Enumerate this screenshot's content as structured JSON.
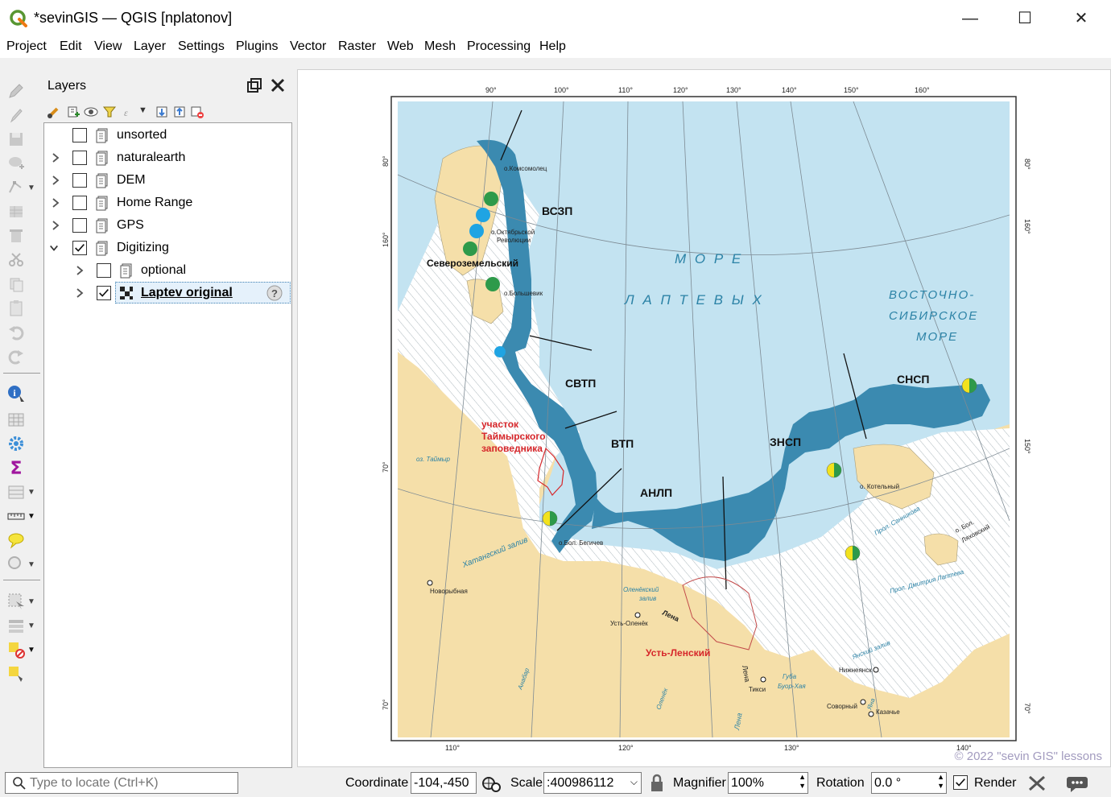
{
  "window": {
    "title": "*sevinGIS — QGIS [nplatonov]",
    "minimize": "—",
    "maximize": "☐",
    "close": "✕"
  },
  "menu": [
    "Project",
    "Edit",
    "View",
    "Layer",
    "Settings",
    "Plugins",
    "Vector",
    "Raster",
    "Web",
    "Mesh",
    "Processing",
    "Help"
  ],
  "layers_panel": {
    "title": "Layers",
    "items": [
      {
        "label": "unsorted",
        "checked": false,
        "expander": "none"
      },
      {
        "label": "naturalearth",
        "checked": false,
        "expander": "collapsed"
      },
      {
        "label": "DEM",
        "checked": false,
        "expander": "collapsed"
      },
      {
        "label": "Home Range",
        "checked": false,
        "expander": "collapsed"
      },
      {
        "label": "GPS",
        "checked": false,
        "expander": "collapsed"
      },
      {
        "label": "Digitizing",
        "checked": true,
        "expander": "expanded"
      },
      {
        "label": "optional",
        "checked": false,
        "expander": "collapsed"
      },
      {
        "label": "Laptev original",
        "checked": true,
        "expander": "collapsed",
        "selected": true,
        "indicator": "?"
      }
    ]
  },
  "map": {
    "top_longitudes": [
      "90°",
      "100°",
      "110°",
      "120°",
      "130°",
      "140°",
      "150°",
      "160°"
    ],
    "bottom_longitudes": [
      "110°",
      "120°",
      "130°",
      "140°"
    ],
    "left_latitudes": [
      "80°",
      "160°",
      "150°",
      "70°"
    ],
    "right_latitudes": [
      "80°",
      "160°",
      "150°",
      "70°"
    ],
    "labels": {
      "sea1": "М О Р Е",
      "sea2": "Л А П Т Е В Ы Х",
      "ess1": "ВОСТОЧНО-",
      "ess2": "СИБИРСКОЕ",
      "ess3": "МОРЕ",
      "vszp": "ВСЗП",
      "svtp": "СВТП",
      "vtp": "ВТП",
      "anlp": "АНЛП",
      "znsp": "ЗНСП",
      "snsp": "СНСП",
      "severozem": "Североземельский",
      "komsomolets": "о.Комсомолец",
      "oktrev1": "о.Октябрьской",
      "oktrev2": "Революции",
      "bolshevik": "о.Большевик",
      "taymyr1": "участок",
      "taymyr2": "Таймырского",
      "taymyr3": "заповедника",
      "oztaymyr": "оз. Таймыр",
      "khatanga": "Хатангский залив",
      "begichev": "о.Бол. Бегичев",
      "novorybnaya": "Новорыбная",
      "olenek_bay1": "Оленёкский",
      "olenek_bay2": "залив",
      "ust_olenek": "Усть-Оленёк",
      "lena": "Лена",
      "lena2": "Лена",
      "lena3": "Лена",
      "ust_lensky": "Усть-Ленский",
      "tiksi": "Тикси",
      "buor1": "Губа",
      "buor2": "Буор-Хая",
      "anabar": "Анабар",
      "olenek_river": "Оленёк",
      "kotelny": "о. Котельный",
      "sannikov": "Прол. Санникова",
      "lyakhov1": "о. Бол.",
      "lyakhov2": "Ляховский",
      "laptev_strait": "Прол. Дмитрия Лаптева",
      "yana_bay": "Янский залив",
      "nizhneyansk": "Нижнеянск",
      "sovorny": "Соворный",
      "kazachye": "Казачье",
      "yana": "Яна"
    },
    "watermark": "© 2022 \"sevin GIS\" lessons"
  },
  "statusbar": {
    "locate_placeholder": "Type to locate (Ctrl+K)",
    "coordinate_label": "Coordinate",
    "coordinate_value": "-104,-450",
    "scale_label": "Scale",
    "scale_value": ":400986112",
    "magnifier_label": "Magnifier",
    "magnifier_value": "100%",
    "rotation_label": "Rotation",
    "rotation_value": "0.0 °",
    "render_label": "Render",
    "render_checked": true
  },
  "colors": {
    "sea": "#c3e3f1",
    "land": "#f5dfa9",
    "dark_water": "#3b8ab0",
    "ice": "#ffffff",
    "green": "#2e9a4a",
    "blue": "#1fa4e3",
    "red_label": "#d6262a"
  }
}
